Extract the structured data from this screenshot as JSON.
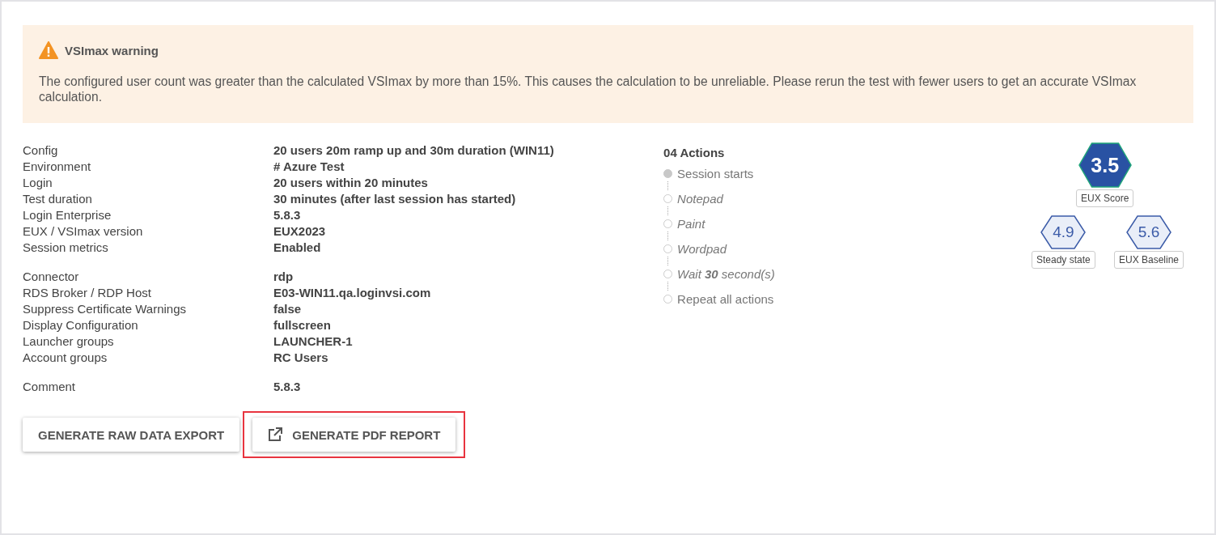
{
  "warning": {
    "title": "VSImax warning",
    "message": "The configured user count was greater than the calculated VSImax by more than 15%. This causes the calculation to be unreliable. Please rerun the test with fewer users to get an accurate VSImax calculation."
  },
  "details": [
    [
      {
        "label": "Config",
        "value": "20 users 20m ramp up and 30m duration (WIN11)"
      },
      {
        "label": "Environment",
        "value": "# Azure Test"
      },
      {
        "label": "Login",
        "value": "20 users within 20 minutes"
      },
      {
        "label": "Test duration",
        "value": "30 minutes (after last session has started)"
      },
      {
        "label": "Login Enterprise",
        "value": "5.8.3"
      },
      {
        "label": "EUX / VSImax version",
        "value": "EUX2023"
      },
      {
        "label": "Session metrics",
        "value": "Enabled"
      }
    ],
    [
      {
        "label": "Connector",
        "value": "rdp"
      },
      {
        "label": "RDS Broker / RDP Host",
        "value": "E03-WIN11.qa.loginvsi.com"
      },
      {
        "label": "Suppress Certificate Warnings",
        "value": "false"
      },
      {
        "label": "Display Configuration",
        "value": "fullscreen"
      },
      {
        "label": "Launcher groups",
        "value": "LAUNCHER-1"
      },
      {
        "label": "Account groups",
        "value": "RC Users"
      }
    ],
    [
      {
        "label": "Comment",
        "value": "5.8.3"
      }
    ]
  ],
  "actions": {
    "title": "04 Actions",
    "items": [
      {
        "kind": "start",
        "label": "Session starts"
      },
      {
        "kind": "app",
        "label": "Notepad"
      },
      {
        "kind": "app",
        "label": "Paint"
      },
      {
        "kind": "app",
        "label": "Wordpad"
      },
      {
        "kind": "app",
        "label": "Wait **30** second(s)"
      },
      {
        "kind": "control",
        "label": "Repeat all actions"
      }
    ]
  },
  "scores": [
    {
      "kind": "primary",
      "value": "3.5",
      "label": "EUX Score"
    },
    {
      "kind": "secondary",
      "value": "4.9",
      "label": "Steady state"
    },
    {
      "kind": "secondary",
      "value": "5.6",
      "label": "EUX Baseline"
    }
  ],
  "buttons": [
    {
      "label": "GENERATE RAW DATA EXPORT",
      "icon": false,
      "highlighted": false
    },
    {
      "label": "GENERATE PDF REPORT",
      "icon": true,
      "highlighted": true
    }
  ]
}
